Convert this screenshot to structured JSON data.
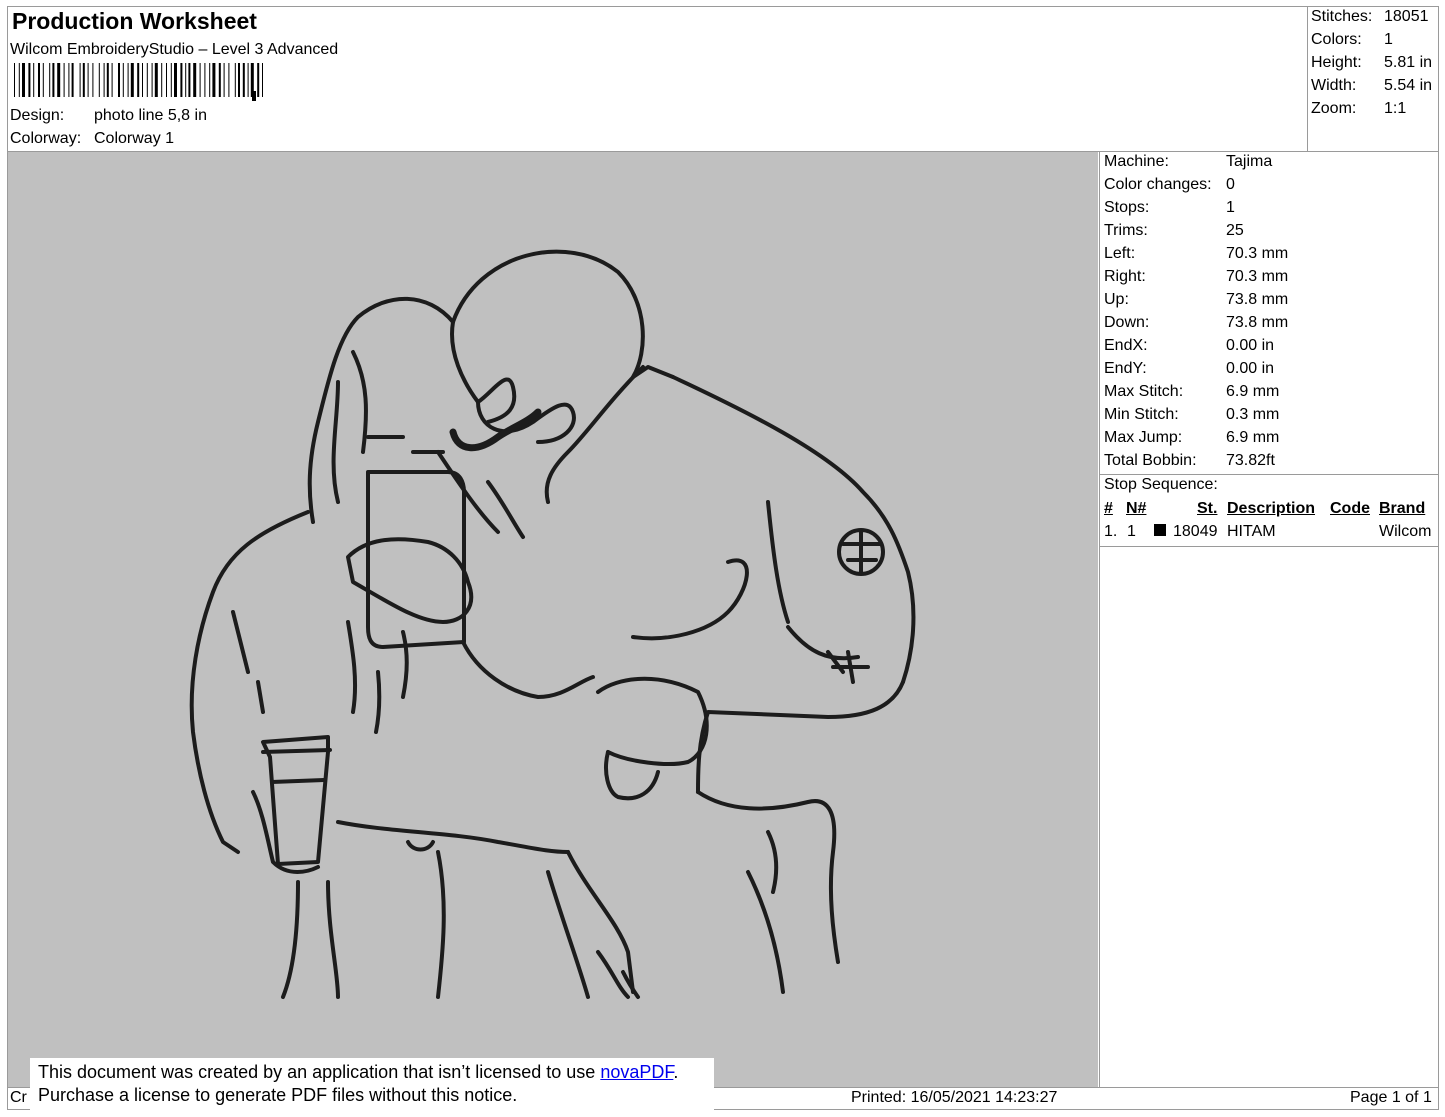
{
  "header": {
    "title": "Production Worksheet",
    "software": "Wilcom EmbroideryStudio – Level 3 Advanced"
  },
  "design": {
    "label": "Design:",
    "value": "photo line 5,8 in"
  },
  "colorway": {
    "label": "Colorway:",
    "value": "Colorway 1"
  },
  "stats": [
    {
      "label": "Stitches:",
      "value": "18051"
    },
    {
      "label": "Colors:",
      "value": "1"
    },
    {
      "label": "Height:",
      "value": "5.81 in"
    },
    {
      "label": "Width:",
      "value": "5.54 in"
    },
    {
      "label": "Zoom:",
      "value": "1:1"
    }
  ],
  "machine_info": [
    {
      "label": "Machine:",
      "value": "Tajima"
    },
    {
      "label": "Color changes:",
      "value": "0"
    },
    {
      "label": "Stops:",
      "value": "1"
    },
    {
      "label": "Trims:",
      "value": "25"
    },
    {
      "label": "Left:",
      "value": "70.3 mm"
    },
    {
      "label": "Right:",
      "value": "70.3 mm"
    },
    {
      "label": "Up:",
      "value": "73.8 mm"
    },
    {
      "label": "Down:",
      "value": "73.8 mm"
    },
    {
      "label": "EndX:",
      "value": "0.00 in"
    },
    {
      "label": "EndY:",
      "value": "0.00 in"
    },
    {
      "label": "Max Stitch:",
      "value": "6.9 mm"
    },
    {
      "label": "Min Stitch:",
      "value": "0.3 mm"
    },
    {
      "label": "Max Jump:",
      "value": "6.9 mm"
    },
    {
      "label": "Total Bobbin:",
      "value": "73.82ft"
    }
  ],
  "stop_sequence": {
    "title": "Stop Sequence:",
    "columns": [
      "#",
      "N#",
      "St.",
      "Description",
      "Code",
      "Brand"
    ],
    "rows": [
      {
        "index": "1.",
        "n": "1",
        "color": "#000000",
        "stitches": "18049",
        "description": "HITAM",
        "code": "",
        "brand": "Wilcom"
      }
    ]
  },
  "footer": {
    "left_fragment": "Cr",
    "printed": "Printed: 16/05/2021 14:23:27",
    "page": "Page 1 of 1"
  },
  "notice": {
    "line1_prefix": "This document was created by an application that isn’t licensed to use ",
    "link_text": "novaPDF",
    "line1_suffix": ".",
    "line2": "Purchase a license to generate PDF files without this notice."
  },
  "colors": {
    "canvas_bg": "#c0c0c0",
    "thread": "#1c1c1c",
    "link": "#0000ee"
  }
}
